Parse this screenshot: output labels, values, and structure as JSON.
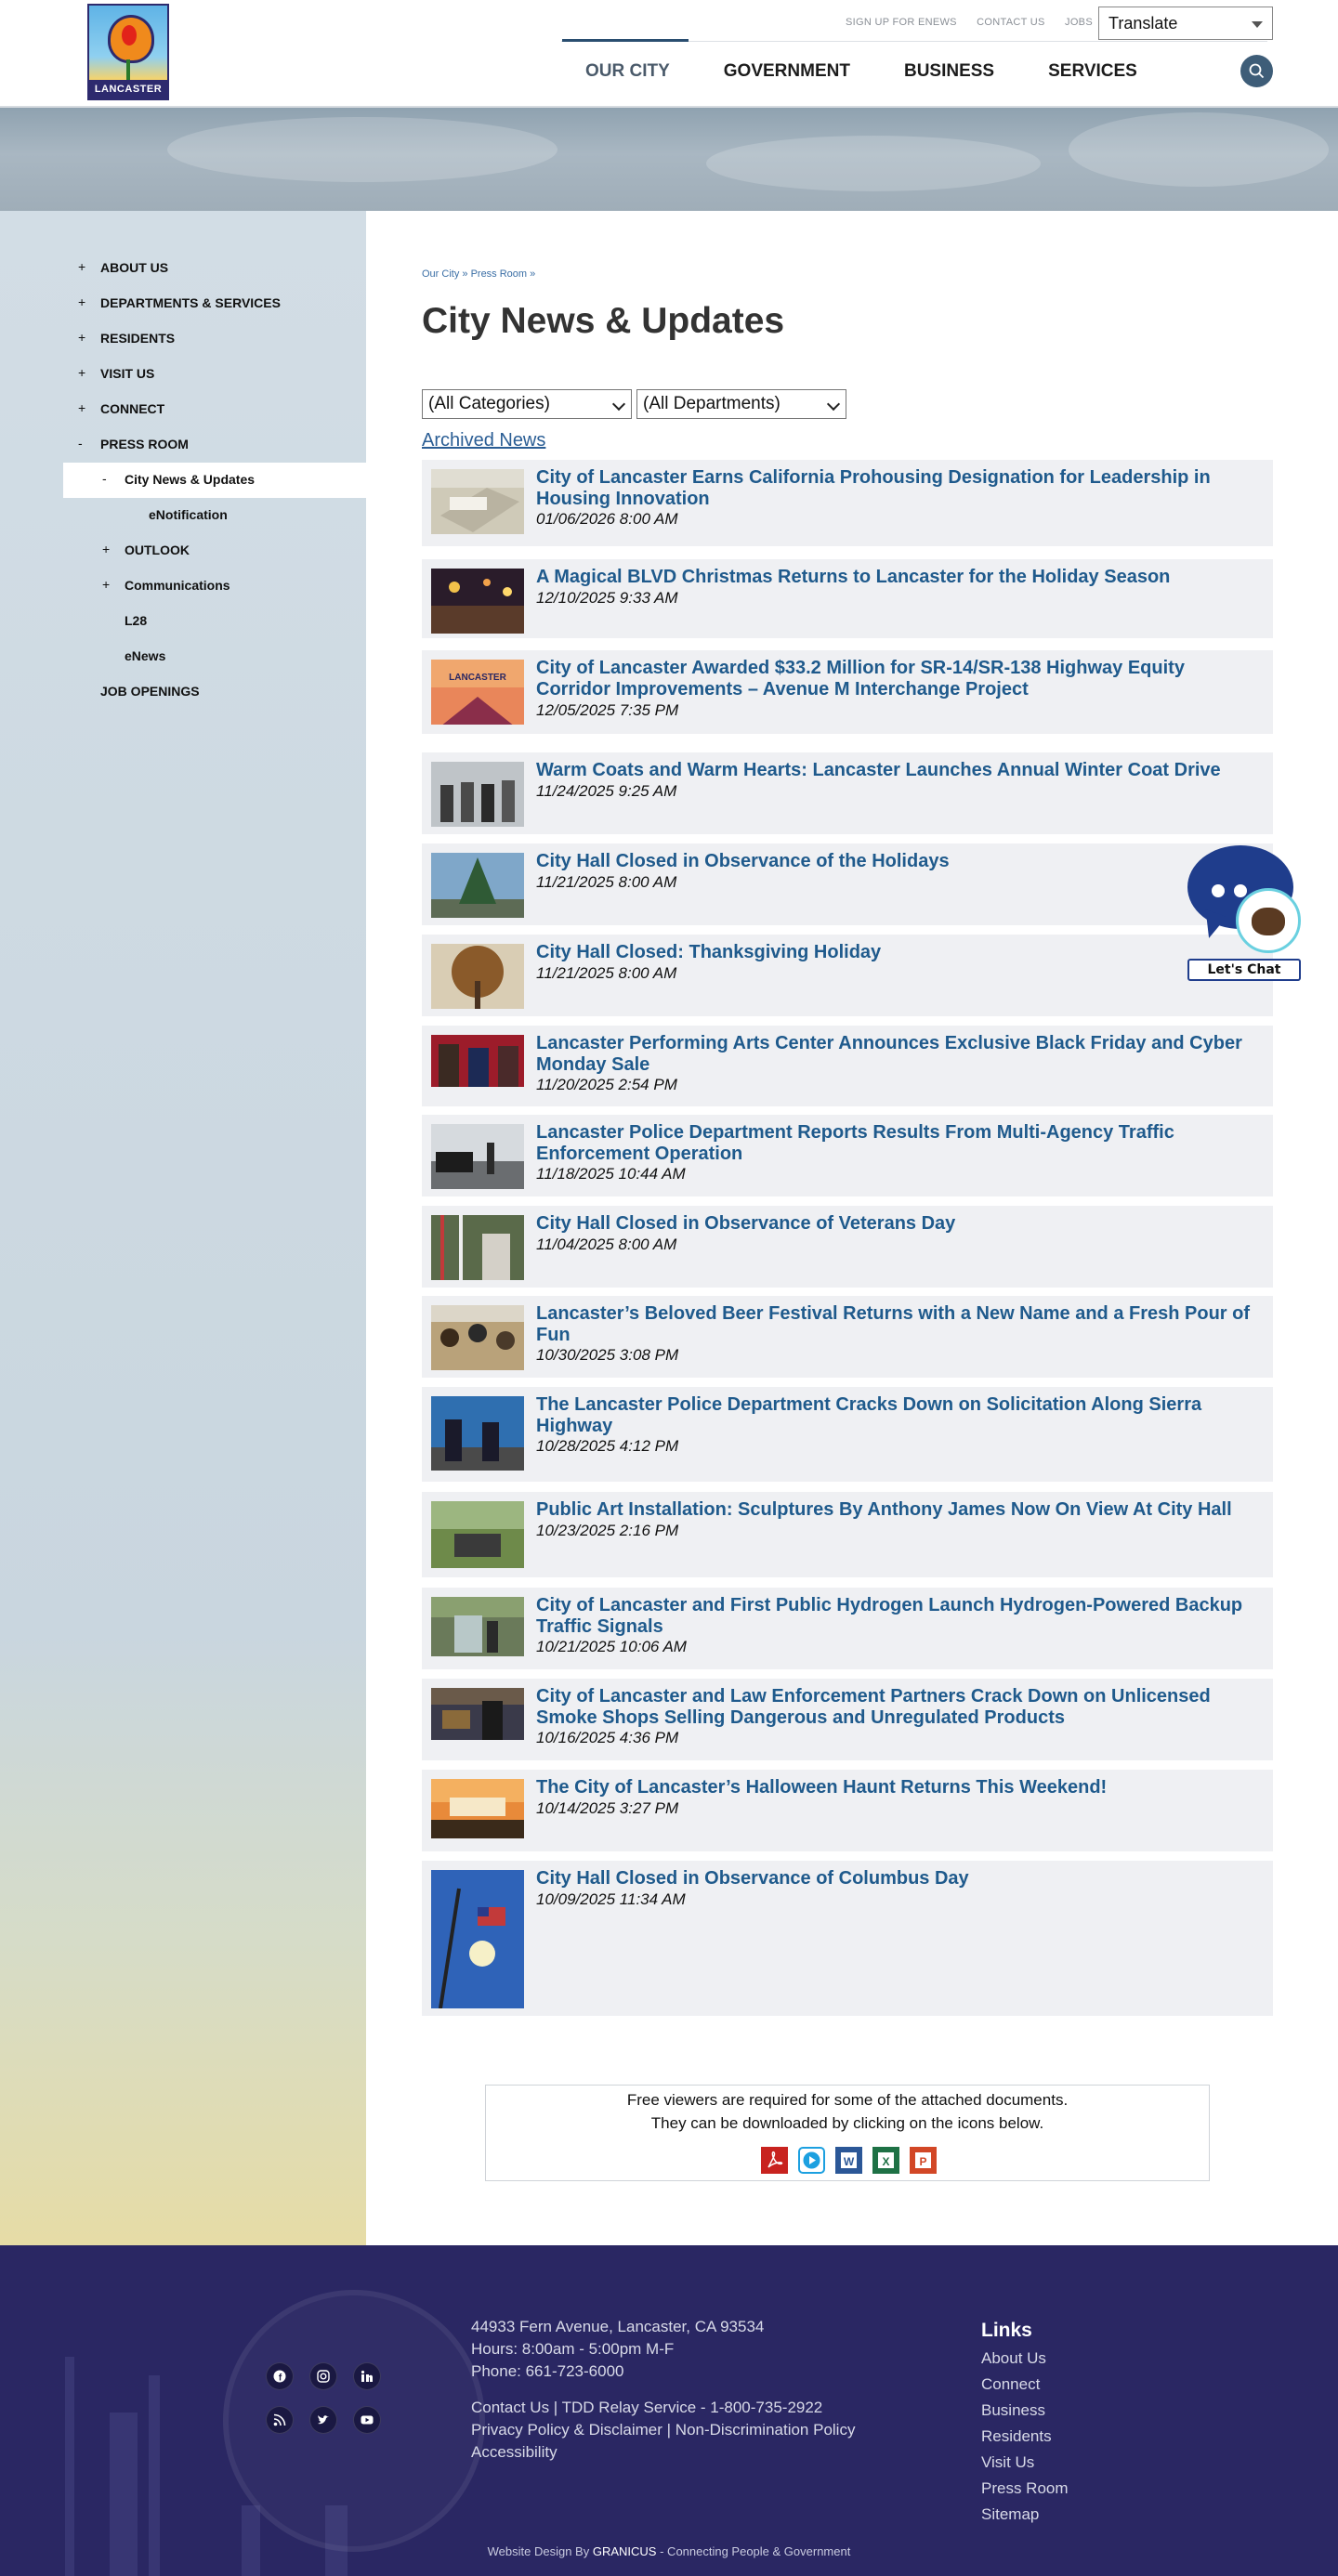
{
  "header": {
    "logo_text": "LANCASTER",
    "utility_links": [
      "SIGN UP FOR ENEWS",
      "CONTACT US",
      "JOBS"
    ],
    "translate_label": "Translate",
    "nav": [
      "OUR CITY",
      "GOVERNMENT",
      "BUSINESS",
      "SERVICES"
    ],
    "active_nav": "OUR CITY"
  },
  "sidebar": {
    "items": [
      {
        "label": "ABOUT US",
        "marker": "+"
      },
      {
        "label": "DEPARTMENTS & SERVICES",
        "marker": "+"
      },
      {
        "label": "RESIDENTS",
        "marker": "+"
      },
      {
        "label": "VISIT US",
        "marker": "+"
      },
      {
        "label": "CONNECT",
        "marker": "+"
      },
      {
        "label": "PRESS ROOM",
        "marker": "-"
      }
    ],
    "sub_items": [
      {
        "label": "City News & Updates",
        "marker": "-"
      },
      {
        "label": "eNotification",
        "marker": ""
      },
      {
        "label": "OUTLOOK",
        "marker": "+"
      },
      {
        "label": "Communications",
        "marker": "+"
      },
      {
        "label": "L28",
        "marker": ""
      },
      {
        "label": "eNews",
        "marker": ""
      }
    ],
    "last_item": "JOB OPENINGS"
  },
  "main": {
    "breadcrumb": "Our City » Press Room »",
    "title": "City News & Updates",
    "category_select": "(All Categories)",
    "department_select": "(All Departments)",
    "archived_link": "Archived News",
    "news": [
      {
        "title": "City of Lancaster Earns California Prohousing Designation for Leadership in Housing Innovation",
        "date": "01/06/2026 8:00 AM"
      },
      {
        "title": "A Magical BLVD Christmas Returns to Lancaster for the Holiday Season",
        "date": "12/10/2025 9:33 AM"
      },
      {
        "title": "City of Lancaster Awarded $33.2 Million for SR-14/SR-138 Highway Equity Corridor Improvements – Avenue M Interchange Project",
        "date": "12/05/2025 7:35 PM",
        "thumb_text": "LANCASTER"
      },
      {
        "title": "Warm Coats and Warm Hearts: Lancaster Launches Annual Winter Coat Drive",
        "date": "11/24/2025 9:25 AM"
      },
      {
        "title": "City Hall Closed in Observance of the Holidays",
        "date": "11/21/2025 8:00 AM"
      },
      {
        "title": "City Hall Closed: Thanksgiving Holiday",
        "date": "11/21/2025 8:00 AM"
      },
      {
        "title": "Lancaster Performing Arts Center Announces Exclusive Black Friday and Cyber Monday Sale",
        "date": "11/20/2025 2:54 PM"
      },
      {
        "title": "Lancaster Police Department Reports Results From Multi-Agency Traffic Enforcement Operation",
        "date": "11/18/2025 10:44 AM"
      },
      {
        "title": "City Hall Closed in Observance of Veterans Day",
        "date": "11/04/2025 8:00 AM"
      },
      {
        "title": "Lancaster’s Beloved Beer Festival Returns with a New Name and a Fresh Pour of Fun",
        "date": "10/30/2025 3:08 PM"
      },
      {
        "title": "The Lancaster Police Department Cracks Down on Solicitation Along Sierra Highway",
        "date": "10/28/2025 4:12 PM"
      },
      {
        "title": "Public Art Installation: Sculptures By Anthony James Now On View At City Hall",
        "date": "10/23/2025 2:16 PM"
      },
      {
        "title": "City of Lancaster and First Public Hydrogen Launch Hydrogen-Powered Backup Traffic Signals",
        "date": "10/21/2025 10:06 AM"
      },
      {
        "title": "City of Lancaster and Law Enforcement Partners Crack Down on Unlicensed Smoke Shops Selling Dangerous and Unregulated Products",
        "date": "10/16/2025 4:36 PM"
      },
      {
        "title": "The City of Lancaster’s Halloween Haunt Returns This Weekend!",
        "date": "10/14/2025 3:27 PM"
      },
      {
        "title": "City Hall Closed in Observance of Columbus Day",
        "date": "10/09/2025 11:34 AM"
      }
    ]
  },
  "chat": {
    "label": "Let's Chat"
  },
  "viewers": {
    "line1": "Free viewers are required for some of the attached documents.",
    "line2": "They can be downloaded by clicking on the icons below.",
    "icons": [
      "pdf-viewer-icon",
      "media-player-icon",
      "word-viewer-icon",
      "excel-viewer-icon",
      "powerpoint-viewer-icon"
    ]
  },
  "footer": {
    "address": "44933 Fern Avenue, Lancaster, CA 93534",
    "hours": "Hours: 8:00am - 5:00pm M-F",
    "phone": "Phone: 661-723-6000",
    "contact_line": "Contact Us | TDD Relay Service - 1-800-735-2922",
    "policy_line": "Privacy Policy & Disclaimer | Non-Discrimination Policy",
    "accessibility": "Accessibility",
    "links_title": "Links",
    "links": [
      "About Us",
      "Connect",
      "Business",
      "Residents",
      "Visit Us",
      "Press Room",
      "Sitemap"
    ],
    "credit_prefix": "Website Design By",
    "credit_brand": "GRANICUS",
    "credit_suffix": "- Connecting People & Government",
    "social_icons": [
      "facebook-icon",
      "instagram-icon",
      "linkedin-icon",
      "rss-icon",
      "twitter-icon",
      "youtube-icon"
    ]
  },
  "colors": {
    "brand_navy": "#2a2763",
    "link_blue": "#1f5a8c",
    "nav_accent": "#2a4e70"
  }
}
